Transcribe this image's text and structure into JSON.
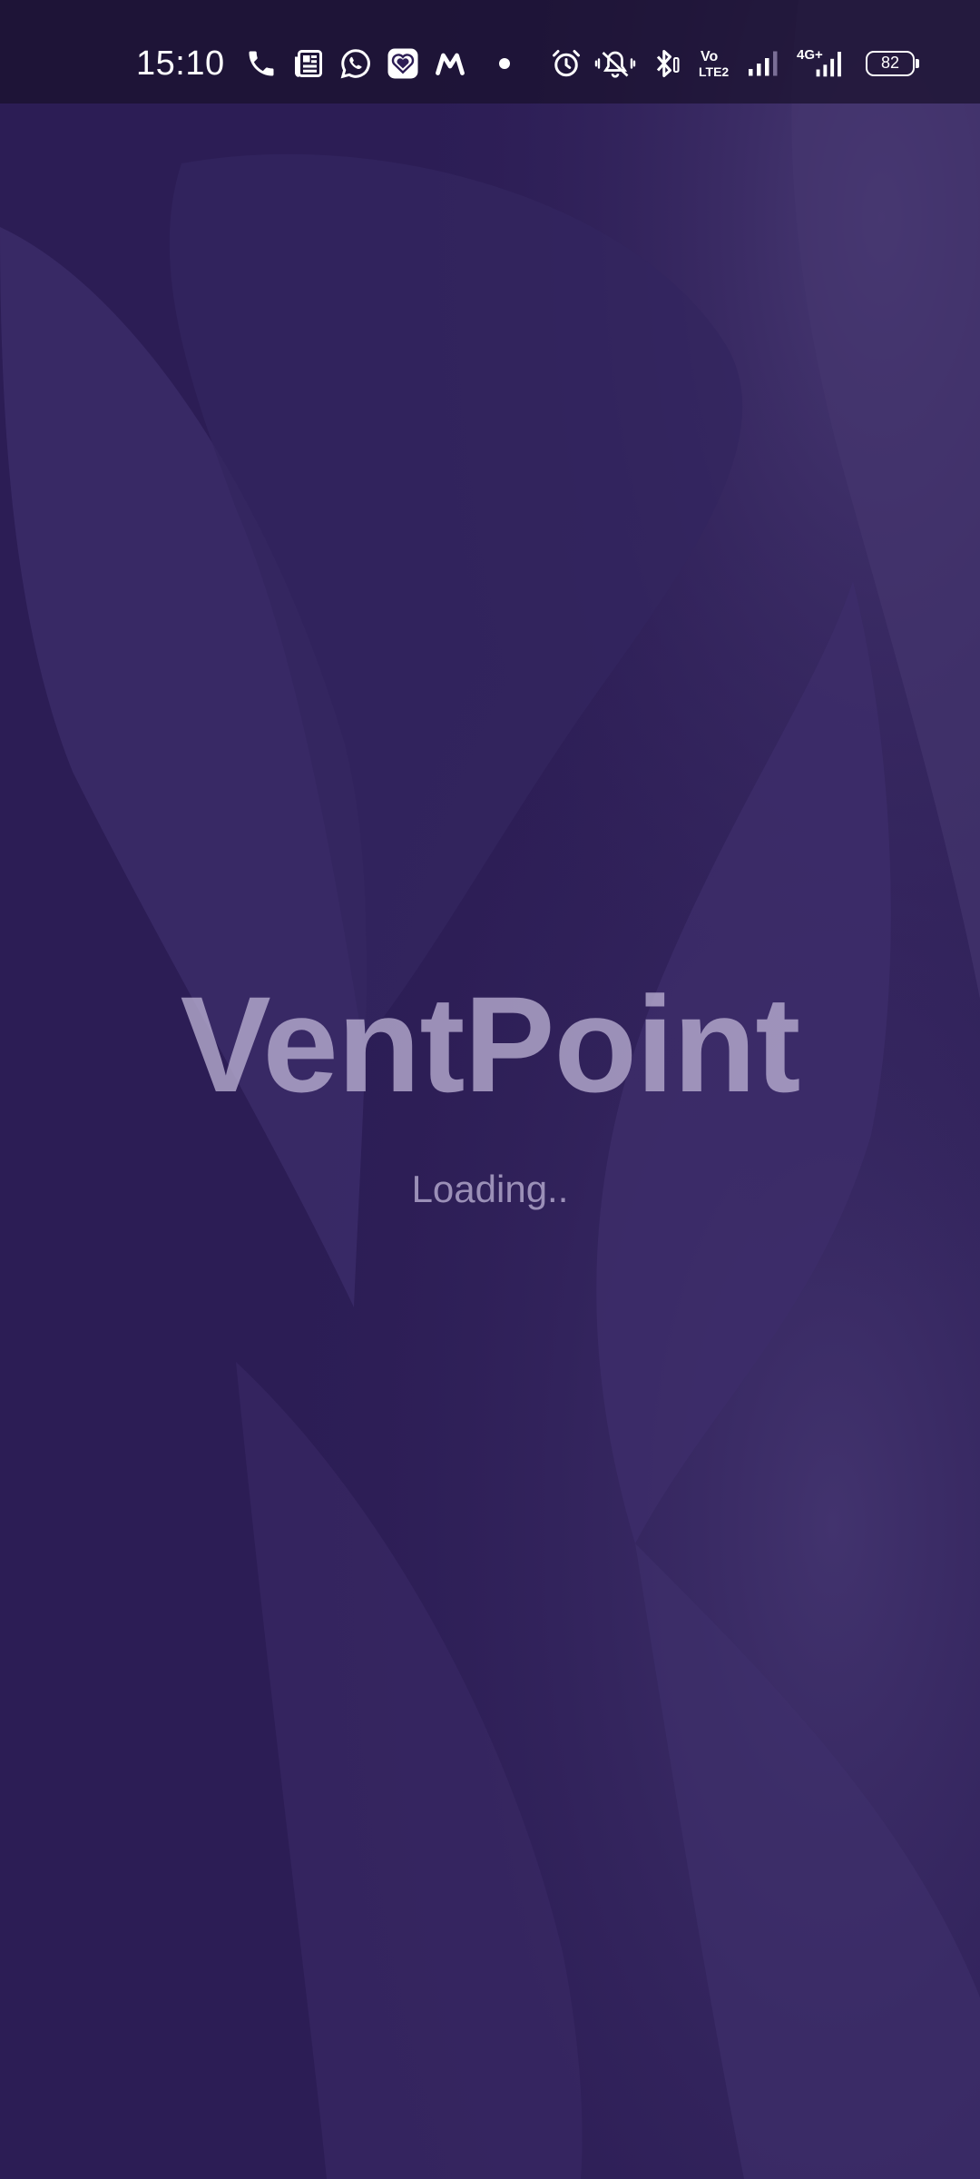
{
  "status_bar": {
    "time": "15:10",
    "battery_level": "82",
    "network_type": "4G+",
    "volte_top": "Vo",
    "volte_bottom": "LTE2",
    "icons": [
      "phone-icon",
      "news-icon",
      "whatsapp-icon",
      "heart-app-icon",
      "myntra-icon",
      "dot-icon",
      "alarm-icon",
      "mute-icon",
      "bluetooth-icon",
      "volte-icon",
      "signal-icon",
      "signal-4g-icon",
      "battery-icon"
    ]
  },
  "splash": {
    "app_title": "VentPoint",
    "loading_text": "Loading.."
  },
  "colors": {
    "background": "#2c1d55",
    "title": "#bab0d2",
    "status_bar": "#19102d"
  }
}
